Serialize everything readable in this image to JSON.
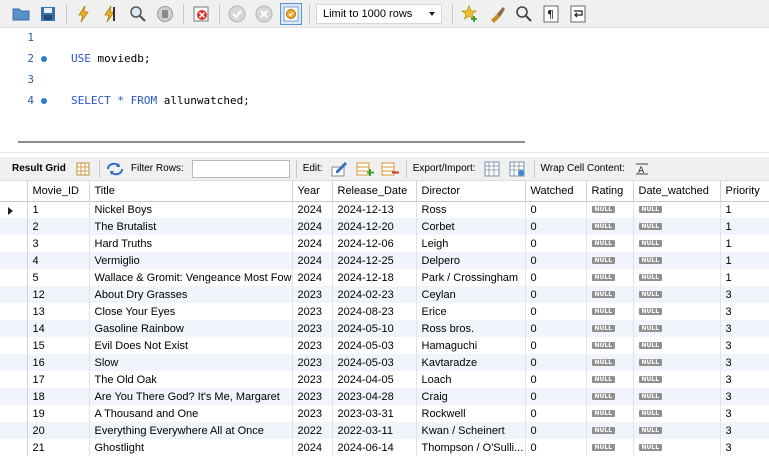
{
  "toolbar": {
    "limit_select_value": "Limit to 1000 rows",
    "icons": [
      "open-folder-icon",
      "save-icon",
      "execute-lightning-icon",
      "execute-cursor-lightning-icon",
      "explain-magnifier-icon",
      "stop-icon",
      "toggle-error-icon",
      "commit-icon",
      "rollback-icon",
      "autocommit-icon",
      "add-snippet-star-icon",
      "beautify-brush-icon",
      "find-icon",
      "invisible-chars-icon",
      "wrap-lines-icon"
    ]
  },
  "editor": {
    "lines": [
      {
        "num": "1",
        "keyword": "",
        "rest": ""
      },
      {
        "num": "2",
        "keyword": "USE",
        "rest": " moviedb;"
      },
      {
        "num": "3",
        "keyword": "",
        "rest": ""
      },
      {
        "num": "4",
        "keyword": "SELECT * FROM",
        "rest": " allunwatched;"
      }
    ]
  },
  "result_toolbar": {
    "result_grid_label": "Result Grid",
    "filter_rows_label": "Filter Rows:",
    "edit_label": "Edit:",
    "export_import_label": "Export/Import:",
    "wrap_cell_label": "Wrap Cell Content:"
  },
  "grid": {
    "columns": [
      "Movie_ID",
      "Title",
      "Year",
      "Release_Date",
      "Director",
      "Watched",
      "Rating",
      "Date_watched",
      "Priority"
    ],
    "null_text": "NULL",
    "rows": [
      [
        "1",
        "Nickel Boys",
        "2024",
        "2024-12-13",
        "Ross",
        "0",
        "NULL",
        "NULL",
        "1"
      ],
      [
        "2",
        "The Brutalist",
        "2024",
        "2024-12-20",
        "Corbet",
        "0",
        "NULL",
        "NULL",
        "1"
      ],
      [
        "3",
        "Hard Truths",
        "2024",
        "2024-12-06",
        "Leigh",
        "0",
        "NULL",
        "NULL",
        "1"
      ],
      [
        "4",
        "Vermiglio",
        "2024",
        "2024-12-25",
        "Delpero",
        "0",
        "NULL",
        "NULL",
        "1"
      ],
      [
        "5",
        "Wallace & Gromit: Vengeance Most Fowl",
        "2024",
        "2024-12-18",
        "Park / Crossingham",
        "0",
        "NULL",
        "NULL",
        "1"
      ],
      [
        "12",
        "About Dry Grasses",
        "2023",
        "2024-02-23",
        "Ceylan",
        "0",
        "NULL",
        "NULL",
        "3"
      ],
      [
        "13",
        "Close Your Eyes",
        "2023",
        "2024-08-23",
        "Erice",
        "0",
        "NULL",
        "NULL",
        "3"
      ],
      [
        "14",
        "Gasoline Rainbow",
        "2023",
        "2024-05-10",
        "Ross bros.",
        "0",
        "NULL",
        "NULL",
        "3"
      ],
      [
        "15",
        "Evil Does Not Exist",
        "2023",
        "2024-05-03",
        "Hamaguchi",
        "0",
        "NULL",
        "NULL",
        "3"
      ],
      [
        "16",
        "Slow",
        "2023",
        "2024-05-03",
        "Kavtaradze",
        "0",
        "NULL",
        "NULL",
        "3"
      ],
      [
        "17",
        "The Old Oak",
        "2023",
        "2024-04-05",
        "Loach",
        "0",
        "NULL",
        "NULL",
        "3"
      ],
      [
        "18",
        "Are You There God? It's Me, Margaret",
        "2023",
        "2023-04-28",
        "Craig",
        "0",
        "NULL",
        "NULL",
        "3"
      ],
      [
        "19",
        "A Thousand and One",
        "2023",
        "2023-03-31",
        "Rockwell",
        "0",
        "NULL",
        "NULL",
        "3"
      ],
      [
        "20",
        "Everything Everywhere All at Once",
        "2022",
        "2022-03-11",
        "Kwan / Scheinert",
        "0",
        "NULL",
        "NULL",
        "3"
      ],
      [
        "21",
        "Ghostlight",
        "2024",
        "2024-06-14",
        "Thompson / O'Sulli...",
        "0",
        "NULL",
        "NULL",
        "3"
      ]
    ]
  },
  "colors": {
    "keyword": "#2a55c7",
    "line_number": "#2e5aa8",
    "alt_row": "#f1f4fb",
    "null_badge": "#909090"
  }
}
